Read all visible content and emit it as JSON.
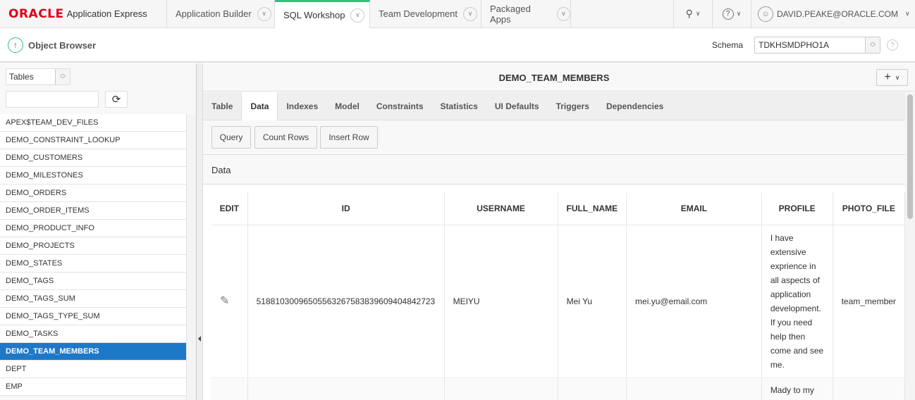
{
  "topnav": {
    "logo_brand": "ORACLE",
    "logo_product": "Application Express",
    "tabs": [
      {
        "label": "Application Builder"
      },
      {
        "label": "SQL Workshop"
      },
      {
        "label": "Team Development"
      },
      {
        "label": "Packaged Apps"
      }
    ],
    "user": "DAVID.PEAKE@ORACLE.COM",
    "active_color": "#2dc57a"
  },
  "subheader": {
    "title": "Object Browser",
    "schema_label": "Schema",
    "schema_value": "TDKHSMDPHO1A",
    "help": "?"
  },
  "sidebar": {
    "object_type": "Tables",
    "search_value": "",
    "items": [
      "APEX$TEAM_DEV_FILES",
      "DEMO_CONSTRAINT_LOOKUP",
      "DEMO_CUSTOMERS",
      "DEMO_MILESTONES",
      "DEMO_ORDERS",
      "DEMO_ORDER_ITEMS",
      "DEMO_PRODUCT_INFO",
      "DEMO_PROJECTS",
      "DEMO_STATES",
      "DEMO_TAGS",
      "DEMO_TAGS_SUM",
      "DEMO_TAGS_TYPE_SUM",
      "DEMO_TASKS",
      "DEMO_TEAM_MEMBERS",
      "DEPT",
      "EMP"
    ],
    "selected": "DEMO_TEAM_MEMBERS",
    "selected_color": "#1e78c8"
  },
  "main": {
    "title": "DEMO_TEAM_MEMBERS",
    "tabs": [
      "Table",
      "Data",
      "Indexes",
      "Model",
      "Constraints",
      "Statistics",
      "UI Defaults",
      "Triggers",
      "Dependencies"
    ],
    "active_tab": "Data",
    "buttons": {
      "query": "Query",
      "count_rows": "Count Rows",
      "insert_row": "Insert Row"
    },
    "region_title": "Data",
    "columns": [
      "EDIT",
      "ID",
      "USERNAME",
      "FULL_NAME",
      "EMAIL",
      "PROFILE",
      "PHOTO_FILE"
    ],
    "rows": [
      {
        "id": "51881030096505563267583839609404842723",
        "username": "MEIYU",
        "full_name": "Mei Yu",
        "email": "mei.yu@email.com",
        "profile": "I have extensive exprience in all aspects of application development. If you need help then come and see me.",
        "photo_file": "team_member"
      },
      {
        "id": "",
        "username": "",
        "full_name": "",
        "email": "",
        "profile": "Mady to my",
        "photo_file": ""
      }
    ]
  }
}
